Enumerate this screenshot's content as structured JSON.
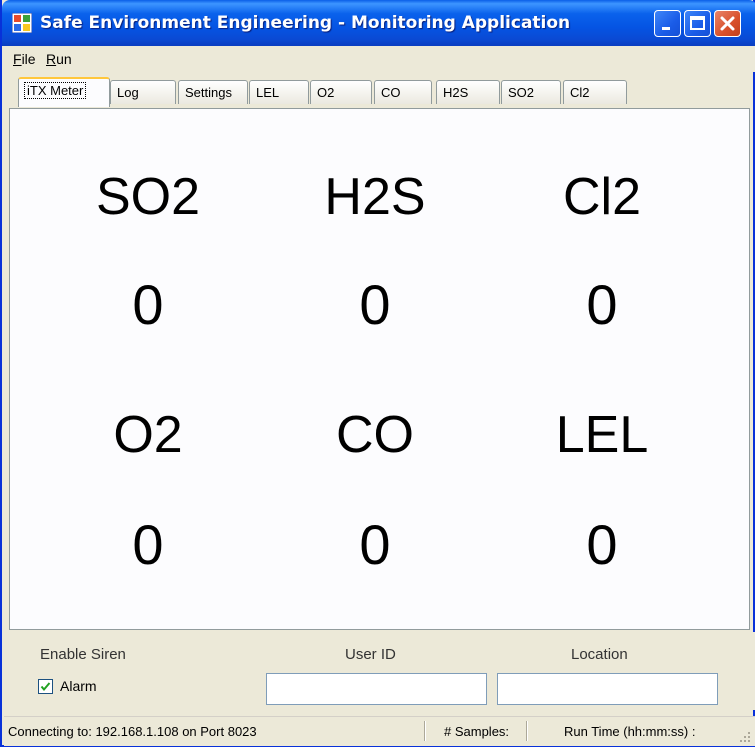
{
  "window": {
    "title": "Safe Environment Engineering - Monitoring Application"
  },
  "menu": {
    "file": {
      "accel": "F",
      "rest": "ile"
    },
    "run": {
      "accel": "R",
      "rest": "un"
    }
  },
  "tabs": [
    "iTX Meter",
    "Log",
    "Settings",
    "LEL",
    "O2",
    "CO",
    "H2S",
    "SO2",
    "Cl2"
  ],
  "active_tab": "iTX Meter",
  "gases": [
    {
      "name": "SO2",
      "value": "0"
    },
    {
      "name": "H2S",
      "value": "0"
    },
    {
      "name": "Cl2",
      "value": "0"
    },
    {
      "name": "O2",
      "value": "0"
    },
    {
      "name": "CO",
      "value": "0"
    },
    {
      "name": "LEL",
      "value": "0"
    }
  ],
  "footer": {
    "enable_siren_label": "Enable Siren",
    "alarm_label": "Alarm",
    "alarm_checked": true,
    "user_id_label": "User ID",
    "user_id_value": "",
    "location_label": "Location",
    "location_value": ""
  },
  "status": {
    "connection": "Connecting to: 192.168.1.108 on Port 8023",
    "samples": "# Samples:",
    "run_time": "Run Time (hh:mm:ss) :"
  },
  "colors": {
    "titlebar": "#0a5fe8",
    "window_face": "#ece9d8",
    "active_tab_highlight": "#ffc73c",
    "check": "#21a121"
  }
}
